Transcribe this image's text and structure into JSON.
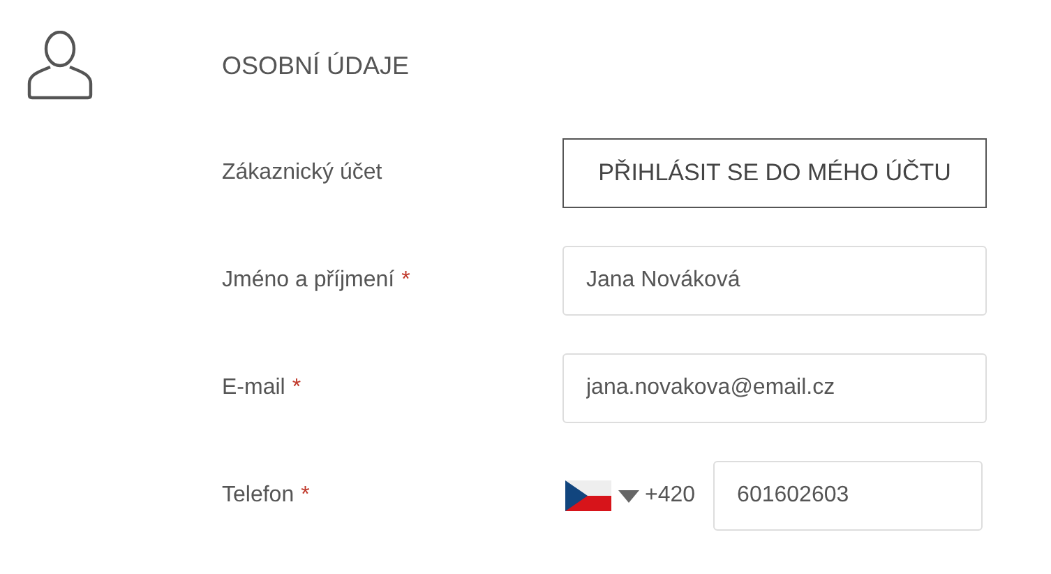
{
  "section": {
    "title": "OSOBNÍ ÚDAJE"
  },
  "rows": [
    {
      "kind": "button",
      "label": "Zákaznický účet",
      "button": "PŘIHLÁSIT SE DO MÉHO ÚČTU"
    },
    {
      "kind": "text",
      "label": "Jméno a příjmení",
      "required_mark": "*",
      "value": "Jana Nováková"
    },
    {
      "kind": "text",
      "label": "E-mail",
      "required_mark": "*",
      "value": "jana.novakova@email.cz"
    },
    {
      "kind": "phone",
      "label": "Telefon",
      "required_mark": "*",
      "prefix": "+420",
      "value": "601602603"
    }
  ]
}
